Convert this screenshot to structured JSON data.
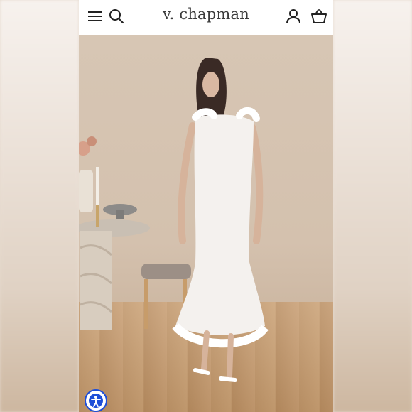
{
  "header": {
    "logo_text": "v. chapman",
    "icons": [
      "menu-icon",
      "search-icon",
      "account-icon",
      "cart-icon"
    ]
  },
  "product_image": {
    "description_hidden": true
  },
  "accessibility": {
    "icon": "accessibility-icon",
    "accent": "#1d4ed8"
  }
}
